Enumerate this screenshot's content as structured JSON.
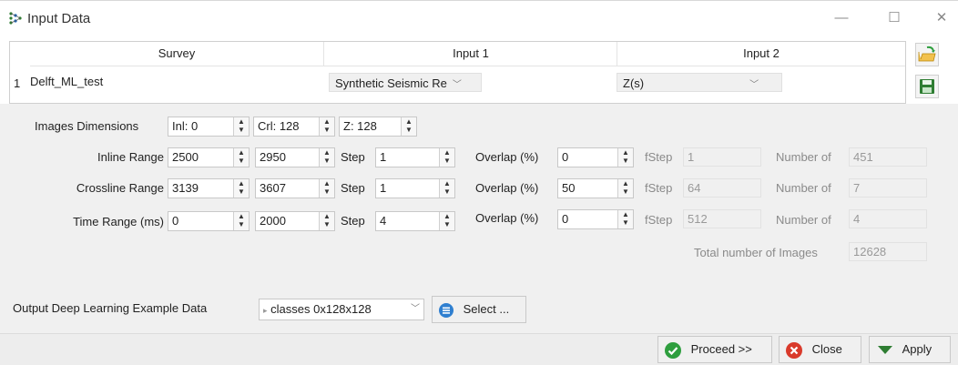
{
  "window": {
    "title": "Input Data"
  },
  "grid": {
    "headers": [
      "Survey",
      "Input 1",
      "Input 2"
    ],
    "row_number": "1",
    "survey": "Delft_ML_test",
    "input1": "Synthetic Seismic Re",
    "input2": "Z(s)"
  },
  "dimensions": {
    "label": "Images Dimensions",
    "inl": "Inl: 0",
    "crl": "Crl: 128",
    "z": "Z: 128"
  },
  "ranges": [
    {
      "label": "Inline Range",
      "from": "2500",
      "to": "2950",
      "step_label": "Step",
      "step": "1",
      "overlap_label": "Overlap (%)",
      "overlap": "0",
      "fstep_label": "fStep",
      "fstep": "1",
      "number_label": "Number of",
      "number": "451"
    },
    {
      "label": "Crossline Range",
      "from": "3139",
      "to": "3607",
      "step_label": "Step",
      "step": "1",
      "overlap_label": "Overlap (%)",
      "overlap": "50",
      "fstep_label": "fStep",
      "fstep": "64",
      "number_label": "Number of",
      "number": "7"
    },
    {
      "label": "Time Range (ms)",
      "from": "0",
      "to": "2000",
      "step_label": "Step",
      "step": "4",
      "overlap_label": "Overlap (%)",
      "overlap": "0",
      "fstep_label": "fStep",
      "fstep": "512",
      "number_label": "Number of",
      "number": "4"
    }
  ],
  "total": {
    "label": "Total number of Images",
    "value": "12628"
  },
  "output": {
    "label": "Output Deep Learning Example Data",
    "value": "classes  0x128x128",
    "select_label": "Select ..."
  },
  "buttons": {
    "proceed": "Proceed >>",
    "close": "Close",
    "apply": "Apply"
  },
  "colors": {
    "accent_green": "#2e9e3e",
    "close_red": "#d93a2b",
    "select_blue": "#2f7fd0"
  }
}
